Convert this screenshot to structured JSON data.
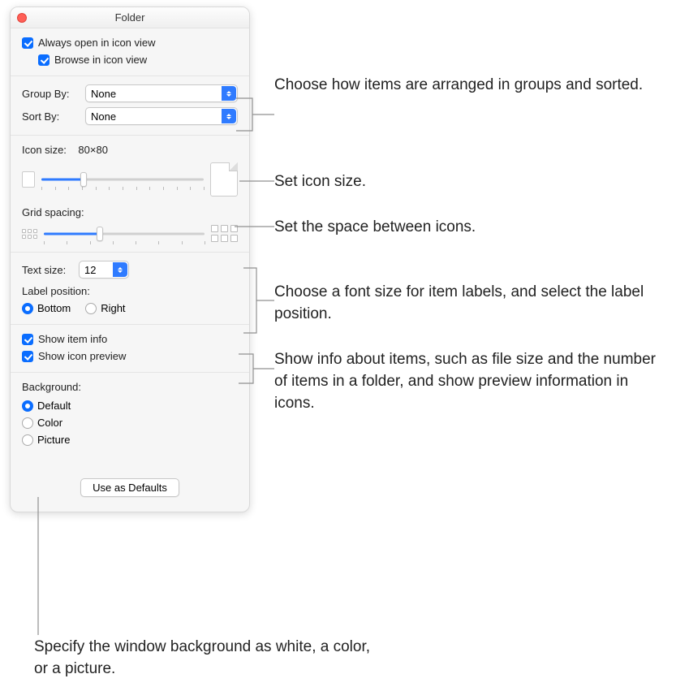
{
  "window": {
    "title": "Folder"
  },
  "top": {
    "always_open": "Always open in icon view",
    "browse": "Browse in icon view"
  },
  "sort": {
    "group_label": "Group By:",
    "group_value": "None",
    "sort_label": "Sort By:",
    "sort_value": "None"
  },
  "icon": {
    "size_label": "Icon size:",
    "size_value": "80×80",
    "grid_label": "Grid spacing:",
    "slider_icon_pct": 26,
    "slider_grid_pct": 35
  },
  "text": {
    "size_label": "Text size:",
    "size_value": "12",
    "pos_label": "Label position:",
    "bottom": "Bottom",
    "right": "Right"
  },
  "info": {
    "item_info": "Show item info",
    "icon_preview": "Show icon preview"
  },
  "bg": {
    "label": "Background:",
    "default": "Default",
    "color": "Color",
    "picture": "Picture"
  },
  "footer": {
    "button": "Use as Defaults"
  },
  "callouts": {
    "c1": "Choose how items are arranged in groups and sorted.",
    "c2": "Set icon size.",
    "c3": "Set the space between icons.",
    "c4": "Choose a font size for item labels, and select the label position.",
    "c5": "Show info about items, such as file size and the number of items in a folder, and show preview information in icons.",
    "c6": "Specify the window background as white, a color, or a picture."
  }
}
